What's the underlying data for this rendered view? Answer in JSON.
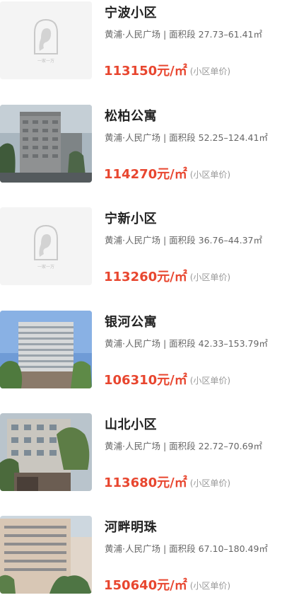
{
  "currency_unit": "元/㎡",
  "price_note": "(小区单价)",
  "listings": [
    {
      "name": "宁波小区",
      "district": "黄浦·人民广场",
      "area_label": "面积段",
      "area_range": "27.73–61.41㎡",
      "price": "113150",
      "photo": "placeholder"
    },
    {
      "name": "松柏公寓",
      "district": "黄浦·人民广场",
      "area_label": "面积段",
      "area_range": "52.25–124.41㎡",
      "price": "114270",
      "photo": "building-photo"
    },
    {
      "name": "宁新小区",
      "district": "黄浦·人民广场",
      "area_label": "面积段",
      "area_range": "36.76–44.37㎡",
      "price": "113260",
      "photo": "placeholder"
    },
    {
      "name": "银河公寓",
      "district": "黄浦·人民广场",
      "area_label": "面积段",
      "area_range": "42.33–153.79㎡",
      "price": "106310",
      "photo": "building-photo"
    },
    {
      "name": "山北小区",
      "district": "黄浦·人民广场",
      "area_label": "面积段",
      "area_range": "22.72–70.69㎡",
      "price": "113680",
      "photo": "building-photo"
    },
    {
      "name": "河畔明珠",
      "district": "黄浦·人民广场",
      "area_label": "面积段",
      "area_range": "67.10–180.49㎡",
      "price": "150640",
      "photo": "building-photo"
    }
  ],
  "placeholder_logo_text": "一家一万",
  "colors": {
    "price": "#e8462f",
    "title": "#222222",
    "meta": "#666666",
    "note": "#999999"
  }
}
